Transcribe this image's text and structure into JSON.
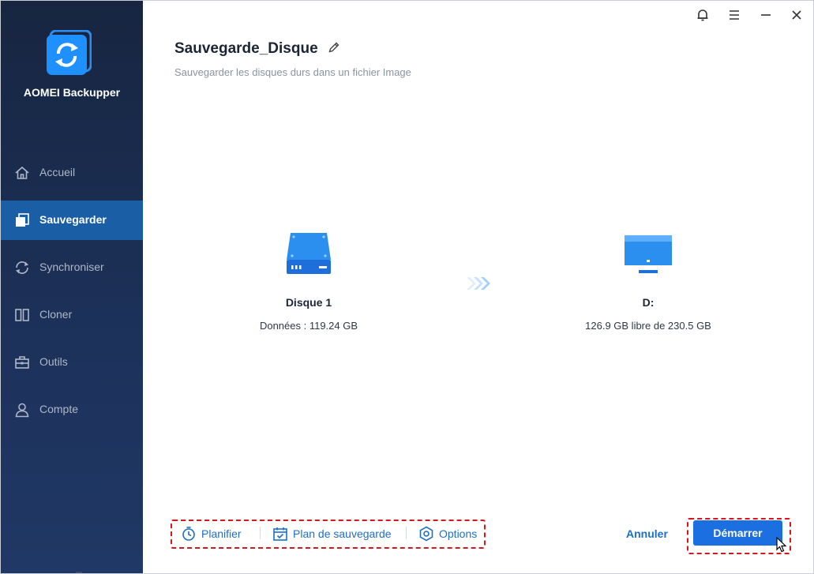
{
  "app": {
    "name": "AOMEI Backupper",
    "logo_icon": "sync-logo-icon"
  },
  "sidebar": {
    "items": [
      {
        "label": "Accueil",
        "icon": "home-icon",
        "active": false
      },
      {
        "label": "Sauvegarder",
        "icon": "backup-icon",
        "active": true
      },
      {
        "label": "Synchroniser",
        "icon": "sync-icon",
        "active": false
      },
      {
        "label": "Cloner",
        "icon": "clone-icon",
        "active": false
      },
      {
        "label": "Outils",
        "icon": "toolbox-icon",
        "active": false
      },
      {
        "label": "Compte",
        "icon": "user-icon",
        "active": false
      }
    ]
  },
  "header": {
    "title": "Sauvegarde_Disque",
    "subtitle": "Sauvegarder les disques durs dans un fichier Image"
  },
  "window_controls": [
    "bell-icon",
    "menu-icon",
    "minimize-icon",
    "close-icon"
  ],
  "source": {
    "name": "Disque 1",
    "info": "Données : 119.24 GB",
    "icon": "hard-disk-icon"
  },
  "destination": {
    "name": "D:",
    "info": "126.9 GB libre de 230.5 GB",
    "icon": "monitor-icon"
  },
  "options": {
    "schedule": "Planifier",
    "scheme": "Plan de sauvegarde",
    "options": "Options"
  },
  "actions": {
    "cancel": "Annuler",
    "start": "Démarrer"
  },
  "colors": {
    "sidebar": "#1c3159",
    "active_nav": "#1a5fa6",
    "accent": "#1c6fc9",
    "highlight": "#d9151c"
  }
}
